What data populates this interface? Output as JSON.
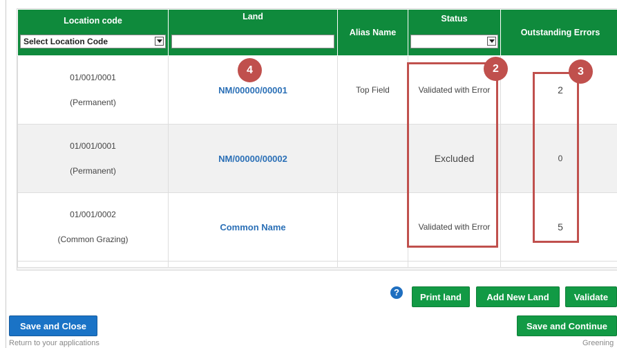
{
  "table": {
    "headers": {
      "location_code": "Location code",
      "location_select_value": "Select Location Code",
      "land": "Land",
      "land_filter_value": "",
      "alias_name": "Alias Name",
      "status": "Status",
      "status_select_value": "",
      "outstanding_errors": "Outstanding Errors"
    },
    "rows": [
      {
        "location_code": "01/001/0001",
        "location_type": "(Permanent)",
        "land": "NM/00000/00001",
        "alias": "Top Field",
        "status": "Validated with Error",
        "errors": "2"
      },
      {
        "location_code": "01/001/0001",
        "location_type": "(Permanent)",
        "land": "NM/00000/00002",
        "alias": "",
        "status": "Excluded",
        "errors": "0"
      },
      {
        "location_code": "01/001/0002",
        "location_type": "(Common Grazing)",
        "land": "Common Name",
        "alias": "",
        "status": "Validated with Error",
        "errors": "5"
      }
    ]
  },
  "markers": {
    "m2": "2",
    "m3": "3",
    "m4": "4"
  },
  "actions": {
    "help_icon": "?",
    "print_land": "Print land",
    "add_new_land": "Add New Land",
    "validate": "Validate",
    "save_and_close": "Save and Close",
    "save_and_continue": "Save and Continue",
    "return_text": "Return to your applications",
    "greening_text": "Greening"
  },
  "colors": {
    "header_green": "#0f8a3c",
    "button_green": "#129a45",
    "button_blue": "#1a73c6",
    "marker_red": "#c0504d",
    "link_blue": "#2a6fb6"
  }
}
